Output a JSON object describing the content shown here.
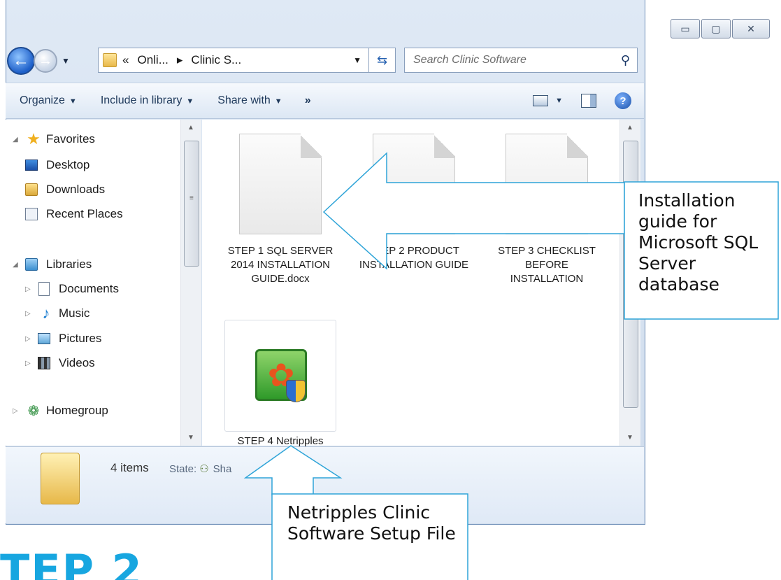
{
  "window": {
    "caption": {
      "minimize": "▭",
      "maximize": "▢",
      "close": "✕"
    }
  },
  "address": {
    "chevron": "«",
    "segments": [
      "Onli...",
      "Clinic S..."
    ],
    "separator": "▸"
  },
  "search": {
    "placeholder": "Search Clinic Software"
  },
  "toolbar": {
    "organize": "Organize",
    "include": "Include in library",
    "share": "Share with",
    "more": "»"
  },
  "navpane": {
    "favorites": "Favorites",
    "desktop": "Desktop",
    "downloads": "Downloads",
    "recent": "Recent Places",
    "libraries": "Libraries",
    "documents": "Documents",
    "music": "Music",
    "pictures": "Pictures",
    "videos": "Videos",
    "homegroup": "Homegroup"
  },
  "files": [
    {
      "name": "STEP 1 SQL SERVER 2014 INSTALLATION GUIDE.docx"
    },
    {
      "name": "STEP 2 PRODUCT INSTALLATION GUIDE"
    },
    {
      "name": "STEP 3 CHECKLIST BEFORE INSTALLATION"
    },
    {
      "name": "STEP 4 Netripples"
    }
  ],
  "details": {
    "count": "4 items",
    "state_label": "State:",
    "state_value": "Sha"
  },
  "callouts": {
    "sql": "Installation guide for Microsoft SQL Server database",
    "setup": "Netripples Clinic Software Setup File"
  },
  "banner": "TEP 2"
}
